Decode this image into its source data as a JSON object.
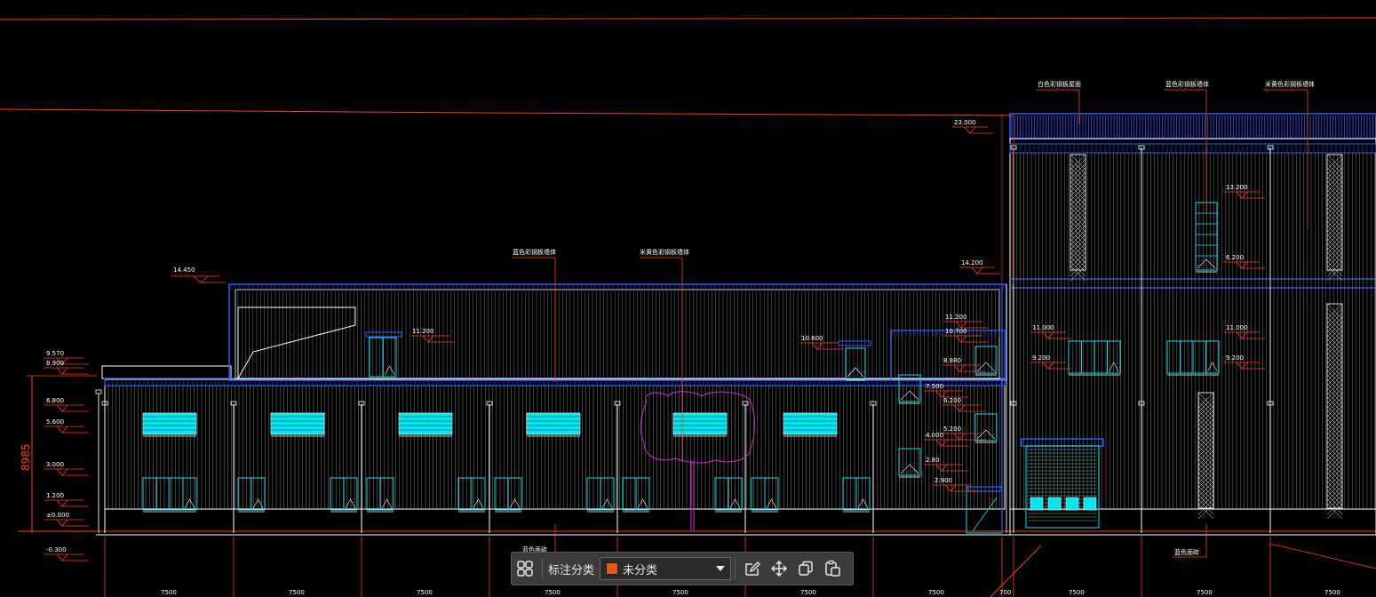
{
  "colors": {
    "background": "#000000",
    "accent_red": "#ff3b1f",
    "wall_line": "#ffffff",
    "edge_blue": "#2f5bff",
    "window_cyan": "#00e5ee",
    "magenta": "#d02ad0",
    "swatch_orange": "#e8581c"
  },
  "elevation_labels_left": [
    "9.570",
    "8.900",
    "6.800",
    "5.600",
    "3.000",
    "1.200",
    "±0.000",
    "-0.300"
  ],
  "overall_dimension": "8985",
  "roof_level": "14.450",
  "mid_levels": [
    "11.200",
    "10.600",
    "11.200",
    "10.700",
    "8.880",
    "7.500",
    "6.200",
    "5.200",
    "4.000",
    "2.80",
    "2.900"
  ],
  "right_levels": [
    "23.000",
    "14.200",
    "13.200",
    "6.200",
    "11.000",
    "9.200",
    "11.000",
    "9.200"
  ],
  "material_notes": {
    "note_1": "白色彩钢板屋面",
    "note_2": "蓝色彩钢板墙体",
    "note_3": "米黄色彩钢板墙体",
    "note_4": "蓝色彩钢板墙体",
    "note_5": "米黄色彩钢板墙体",
    "note_6": "蓝色面砖",
    "note_7": "蓝色面砖"
  },
  "axis_spacings": [
    "7500",
    "7500",
    "7500",
    "7500",
    "7500",
    "7500",
    "7500",
    "700",
    "7500",
    "7500",
    "7500"
  ],
  "toolbar": {
    "category_label": "标注分类",
    "category_value": "未分类",
    "icons": [
      "grid-icon",
      "edit-icon",
      "move-icon",
      "copy-icon",
      "paste-icon"
    ]
  }
}
